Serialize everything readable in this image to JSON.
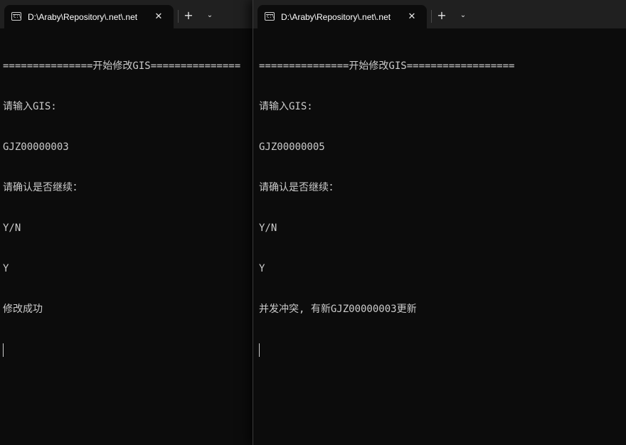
{
  "windows": [
    {
      "tab": {
        "icon": "terminal-icon",
        "icon_glyph": "C:\\",
        "title": "D:\\Araby\\Repository\\.net\\.net",
        "close": "✕",
        "new_tab": "+",
        "dropdown": "⌄"
      },
      "console": {
        "lines": [
          "===============开始修改GIS===============",
          "请输入GIS:",
          "GJZ00000003",
          "请确认是否继续：",
          "Y/N",
          "Y",
          "修改成功"
        ]
      }
    },
    {
      "tab": {
        "icon": "terminal-icon",
        "icon_glyph": "C:\\",
        "title": "D:\\Araby\\Repository\\.net\\.net",
        "close": "✕",
        "new_tab": "+",
        "dropdown": "⌄"
      },
      "console": {
        "lines": [
          "===============开始修改GIS==================",
          "请输入GIS:",
          "GJZ00000005",
          "请确认是否继续：",
          "Y/N",
          "Y",
          "并发冲突, 有新GJZ00000003更新"
        ]
      }
    }
  ],
  "colors": {
    "background": "#0c0c0c",
    "tabbar": "#202020",
    "text": "#cccccc",
    "tab_text": "#ffffff"
  }
}
